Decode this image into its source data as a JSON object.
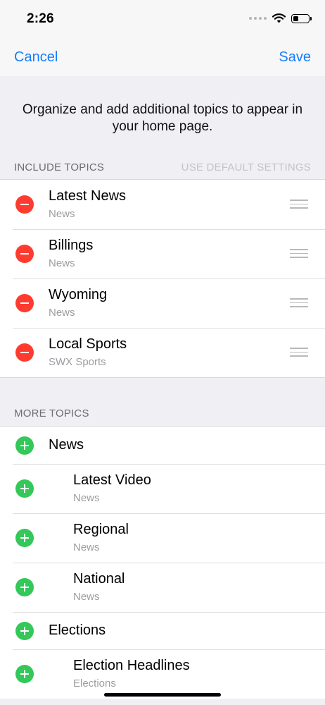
{
  "status": {
    "time": "2:26"
  },
  "nav": {
    "cancel": "Cancel",
    "save": "Save"
  },
  "intro": "Organize and add additional topics to appear in your home page.",
  "include": {
    "header": "INCLUDE TOPICS",
    "action": "USE DEFAULT SETTINGS",
    "items": [
      {
        "title": "Latest News",
        "subtitle": "News"
      },
      {
        "title": "Billings",
        "subtitle": "News"
      },
      {
        "title": "Wyoming",
        "subtitle": "News"
      },
      {
        "title": "Local Sports",
        "subtitle": "SWX Sports"
      }
    ]
  },
  "more": {
    "header": "MORE TOPICS",
    "items": [
      {
        "title": "News"
      },
      {
        "title": "Latest Video",
        "subtitle": "News"
      },
      {
        "title": "Regional",
        "subtitle": "News"
      },
      {
        "title": "National",
        "subtitle": "News"
      },
      {
        "title": "Elections"
      },
      {
        "title": "Election Headlines",
        "subtitle": "Elections"
      }
    ]
  }
}
